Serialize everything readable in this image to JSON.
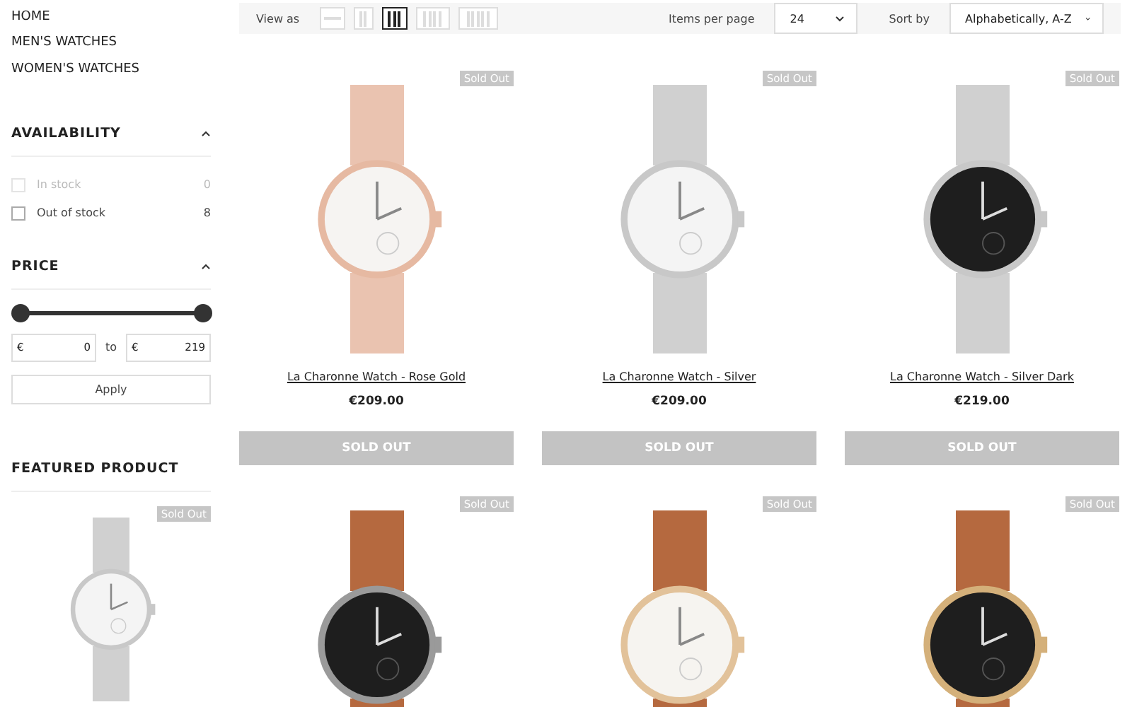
{
  "nav": [
    {
      "label": "HOME"
    },
    {
      "label": "MEN'S WATCHES"
    },
    {
      "label": "WOMEN'S WATCHES"
    }
  ],
  "availability": {
    "title": "AVAILABILITY",
    "expanded": true,
    "options": [
      {
        "label": "In stock",
        "count": "0",
        "checked": false,
        "disabled": true
      },
      {
        "label": "Out of stock",
        "count": "8",
        "checked": false,
        "disabled": false
      }
    ]
  },
  "price": {
    "title": "PRICE",
    "expanded": true,
    "thumbs": [
      {
        "level": 0
      },
      {
        "level": 1
      }
    ],
    "from": {
      "currency": "€",
      "value": "0"
    },
    "separator": "to",
    "to": {
      "currency": "€",
      "value": "219"
    },
    "apply": "Apply"
  },
  "featured": {
    "title": "FEATURED PRODUCT",
    "badge": "Sold Out",
    "kind": "silver"
  },
  "toolbar": {
    "view_label": "View as",
    "views": [
      {
        "kind": "list",
        "selected": false
      },
      {
        "kind": "grid2",
        "selected": false
      },
      {
        "kind": "grid3",
        "selected": true
      },
      {
        "kind": "grid4",
        "selected": false
      },
      {
        "kind": "grid5",
        "selected": false
      }
    ],
    "per_page_label": "Items per page",
    "per_page": "24",
    "sort_label": "Sort by",
    "sort": "Alphabetically, A-Z"
  },
  "products": [
    {
      "badge": "Sold Out",
      "name": "La Charonne Watch - Rose Gold",
      "price": "€209.00",
      "button": "SOLD OUT",
      "kind": "rosegold"
    },
    {
      "badge": "Sold Out",
      "name": "La Charonne Watch - Silver",
      "price": "€209.00",
      "button": "SOLD OUT",
      "kind": "silver"
    },
    {
      "badge": "Sold Out",
      "name": "La Charonne Watch - Silver Dark",
      "price": "€219.00",
      "button": "SOLD OUT",
      "kind": "silverdark"
    },
    {
      "badge": "Sold Out",
      "kind": "gunmetal"
    },
    {
      "badge": "Sold Out",
      "kind": "goldwhite"
    },
    {
      "badge": "Sold Out",
      "kind": "goldblack"
    }
  ]
}
